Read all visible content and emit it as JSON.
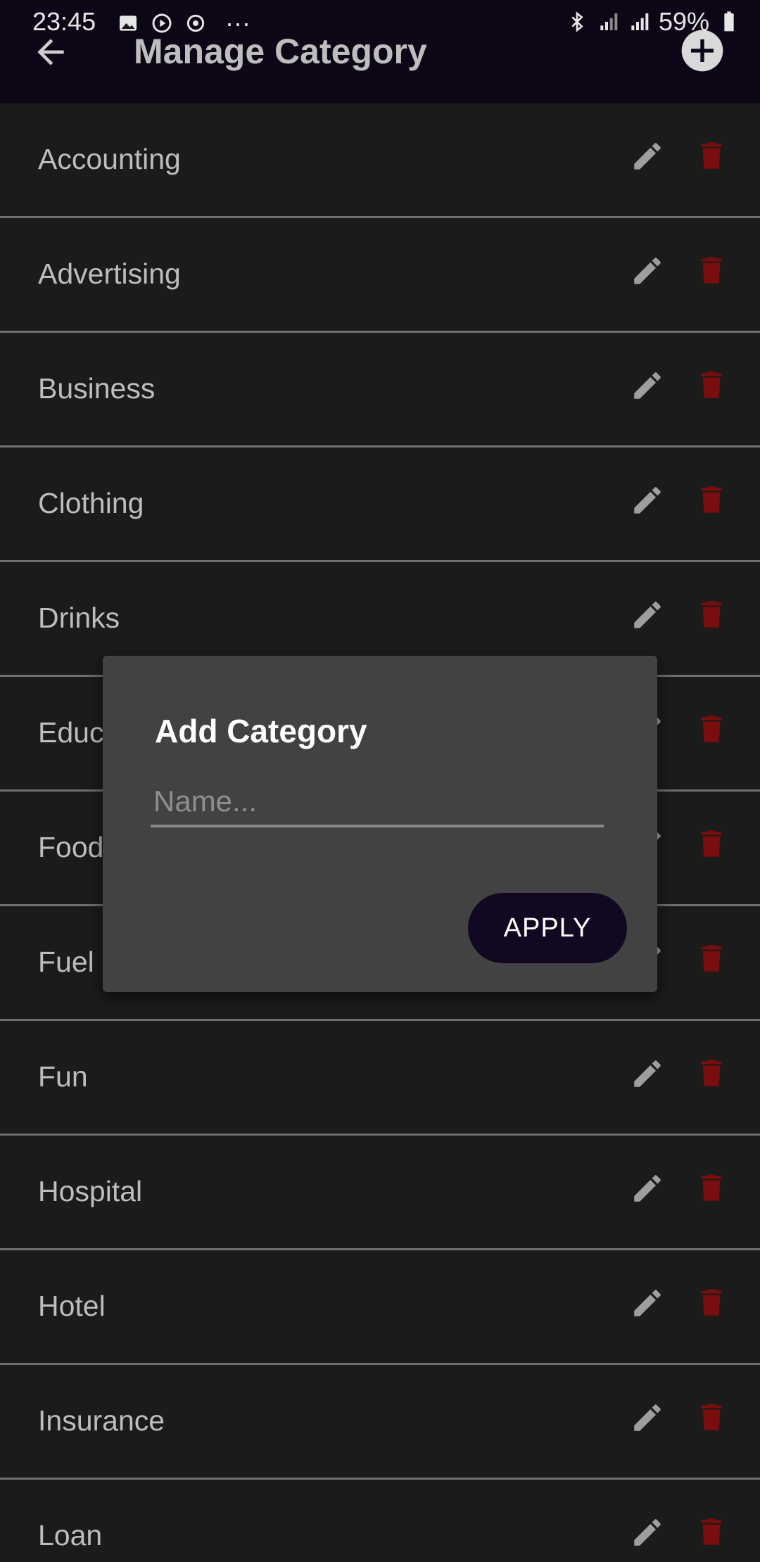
{
  "status_bar": {
    "time": "23:45",
    "battery": "59%",
    "icons_left": [
      "image-icon",
      "play-icon",
      "sync-icon",
      "more-dots-icon"
    ],
    "icons_right": [
      "bluetooth-icon",
      "signal-icon",
      "signal-icon",
      "battery-icon"
    ],
    "more": "···"
  },
  "app_bar": {
    "title": "Manage Category",
    "back_icon": "back-arrow-icon",
    "add_icon": "add-circle-icon"
  },
  "categories": [
    {
      "label": "Accounting"
    },
    {
      "label": "Advertising"
    },
    {
      "label": "Business"
    },
    {
      "label": "Clothing"
    },
    {
      "label": "Drinks"
    },
    {
      "label": "Educ"
    },
    {
      "label": "Food"
    },
    {
      "label": "Fuel"
    },
    {
      "label": "Fun"
    },
    {
      "label": "Hospital"
    },
    {
      "label": "Hotel"
    },
    {
      "label": "Insurance"
    },
    {
      "label": "Loan"
    }
  ],
  "dialog": {
    "title": "Add Category",
    "input_placeholder": "Name...",
    "input_value": "",
    "apply_label": "APPLY"
  },
  "colors": {
    "app_bar": "#0c0617",
    "background": "#1b1b1b",
    "divider": "#6f6f6f",
    "dialog": "#424242",
    "delete": "#7a0d0d",
    "edit": "#9e9e9e",
    "apply_button": "#120822",
    "caret": "#5fb3a6"
  }
}
